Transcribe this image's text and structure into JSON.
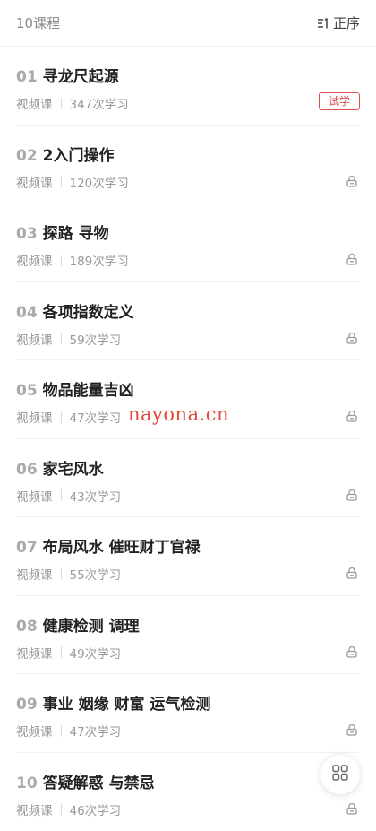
{
  "header": {
    "count_label": "10课程",
    "sort_label": "正序"
  },
  "watermark": "nayona.cn",
  "lessons": [
    {
      "num": "01",
      "title": "寻龙尺起源",
      "type": "视频课",
      "views": "347次学习",
      "badge": "试学",
      "locked": false
    },
    {
      "num": "02",
      "title": "2入门操作",
      "type": "视频课",
      "views": "120次学习",
      "badge": "",
      "locked": true
    },
    {
      "num": "03",
      "title": "探路 寻物",
      "type": "视频课",
      "views": "189次学习",
      "badge": "",
      "locked": true
    },
    {
      "num": "04",
      "title": "各项指数定义",
      "type": "视频课",
      "views": "59次学习",
      "badge": "",
      "locked": true
    },
    {
      "num": "05",
      "title": "物品能量吉凶",
      "type": "视频课",
      "views": "47次学习",
      "badge": "",
      "locked": true
    },
    {
      "num": "06",
      "title": "家宅风水",
      "type": "视频课",
      "views": "43次学习",
      "badge": "",
      "locked": true
    },
    {
      "num": "07",
      "title": "布局风水 催旺财丁官禄",
      "type": "视频课",
      "views": "55次学习",
      "badge": "",
      "locked": true
    },
    {
      "num": "08",
      "title": "健康检测 调理",
      "type": "视频课",
      "views": "49次学习",
      "badge": "",
      "locked": true
    },
    {
      "num": "09",
      "title": "事业 姻缘 财富 运气检测",
      "type": "视频课",
      "views": "47次学习",
      "badge": "",
      "locked": true
    },
    {
      "num": "10",
      "title": "答疑解惑 与禁忌",
      "type": "视频课",
      "views": "46次学习",
      "badge": "",
      "locked": true
    }
  ],
  "colors": {
    "accent": "#d9534f",
    "watermark": "#e4473b",
    "muted": "#999999"
  },
  "icons": {
    "sort": "sort-order-icon",
    "lock": "lock-icon",
    "grid": "grid-menu-icon"
  }
}
